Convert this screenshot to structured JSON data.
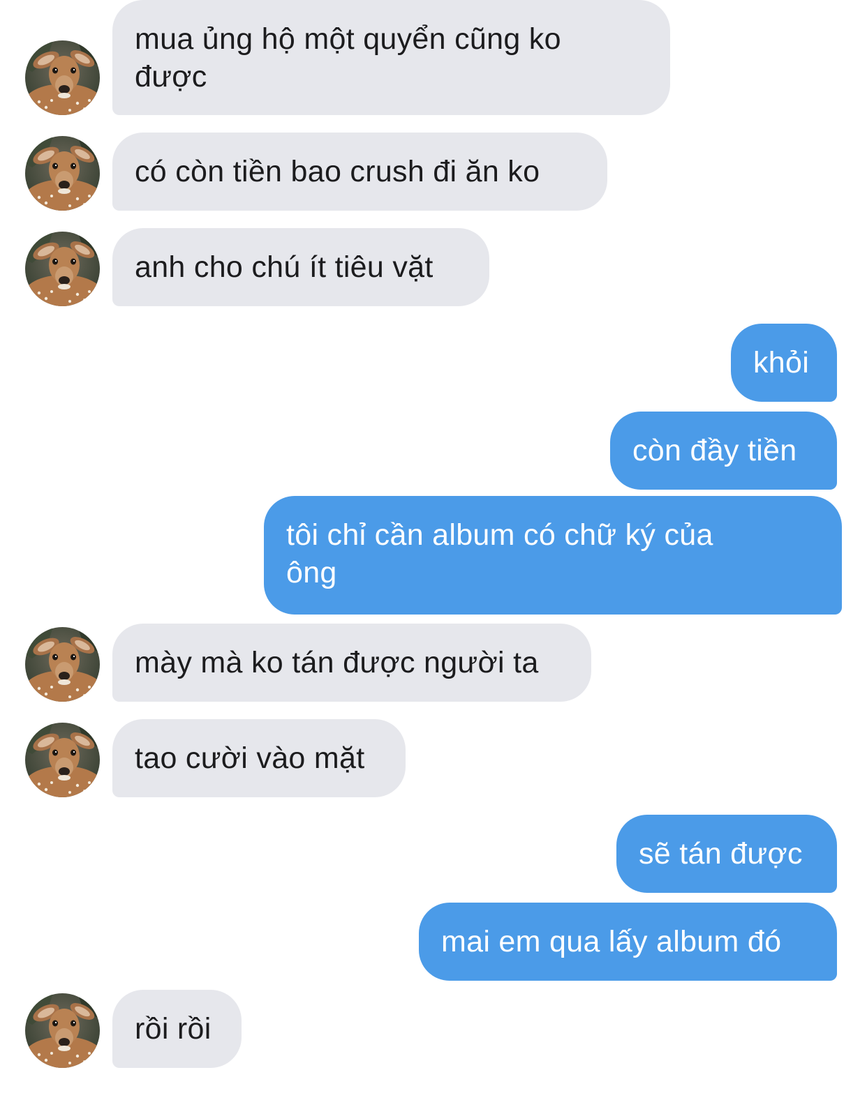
{
  "conversation": {
    "messages": [
      {
        "side": "in",
        "text": "mua ủng hộ một quyển cũng ko\nđược"
      },
      {
        "side": "in",
        "text": "có còn tiền bao crush đi ăn ko"
      },
      {
        "side": "in",
        "text": "anh cho chú ít tiêu vặt"
      },
      {
        "side": "out",
        "text": "khỏi"
      },
      {
        "side": "out",
        "text": "còn đầy tiền"
      },
      {
        "side": "out",
        "text": "tôi chỉ cần album có chữ ký của\nông"
      },
      {
        "side": "in",
        "text": "mày mà ko tán được người ta"
      },
      {
        "side": "in",
        "text": "tao cười vào mặt"
      },
      {
        "side": "out",
        "text": "sẽ tán được"
      },
      {
        "side": "out",
        "text": "mai em qua lấy album đó"
      },
      {
        "side": "in",
        "text": "rồi rồi"
      }
    ]
  },
  "contact": {
    "avatar_icon": "deer-avatar-icon"
  },
  "colors": {
    "incoming_bubble": "#e6e7ec",
    "outgoing_bubble": "#4b9be8",
    "incoming_text": "#1c1c1e",
    "outgoing_text": "#ffffff"
  }
}
